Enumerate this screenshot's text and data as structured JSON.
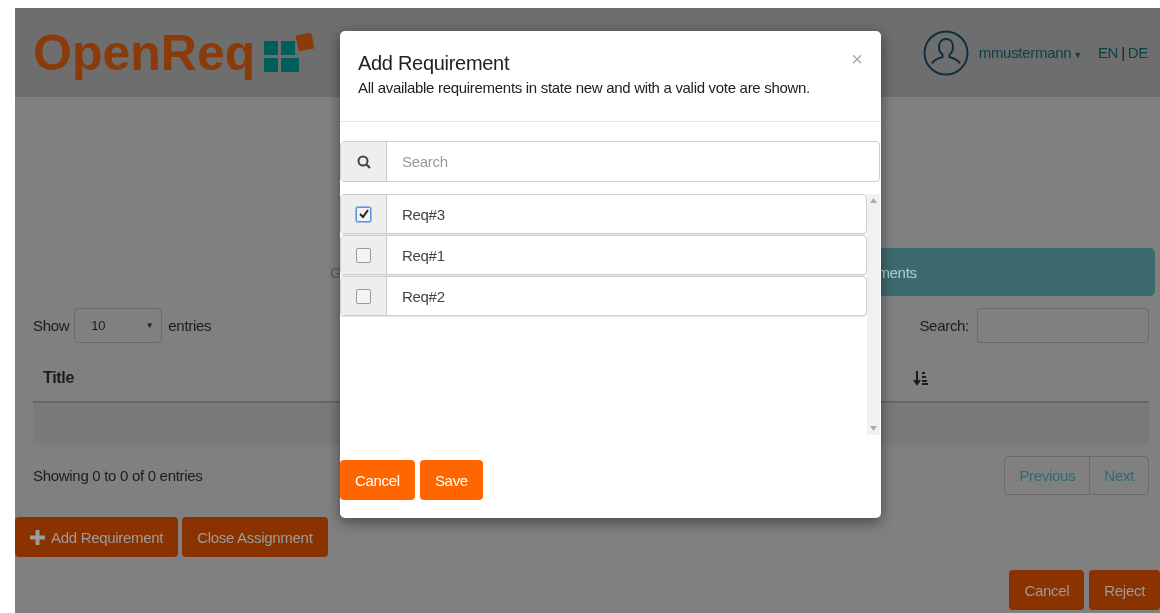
{
  "header": {
    "logo": "OpenReq",
    "user": "mmustermann",
    "user_caret": "▼",
    "languages": [
      "EN",
      "DE"
    ],
    "language_separator": "|"
  },
  "tabs": [
    {
      "label": "G",
      "selected": false
    },
    {
      "label": "ments",
      "selected": true
    }
  ],
  "table_controls": {
    "show_label": "Show",
    "page_size": "10",
    "page_size_caret": "▼",
    "entries_label": "entries",
    "search_label": "Search:"
  },
  "table": {
    "columns": [
      "Title"
    ]
  },
  "info": "Showing 0 to 0 of 0 entries",
  "pagination": [
    "Previous",
    "Next"
  ],
  "actions": [
    {
      "label": "Add Requirement",
      "kind": "add"
    },
    {
      "label": "Close Assignment",
      "kind": "plain"
    }
  ],
  "footer_buttons": [
    "Cancel",
    "Reject"
  ],
  "modal": {
    "title": "Add Requirement",
    "subtitle": "All available requirements in state new and with a valid vote are shown.",
    "close": "×",
    "search_placeholder": "Search",
    "items": [
      {
        "label": "Req#3",
        "checked": true
      },
      {
        "label": "Req#1",
        "checked": false
      },
      {
        "label": "Req#2",
        "checked": false
      }
    ],
    "buttons": [
      "Cancel",
      "Save"
    ]
  }
}
